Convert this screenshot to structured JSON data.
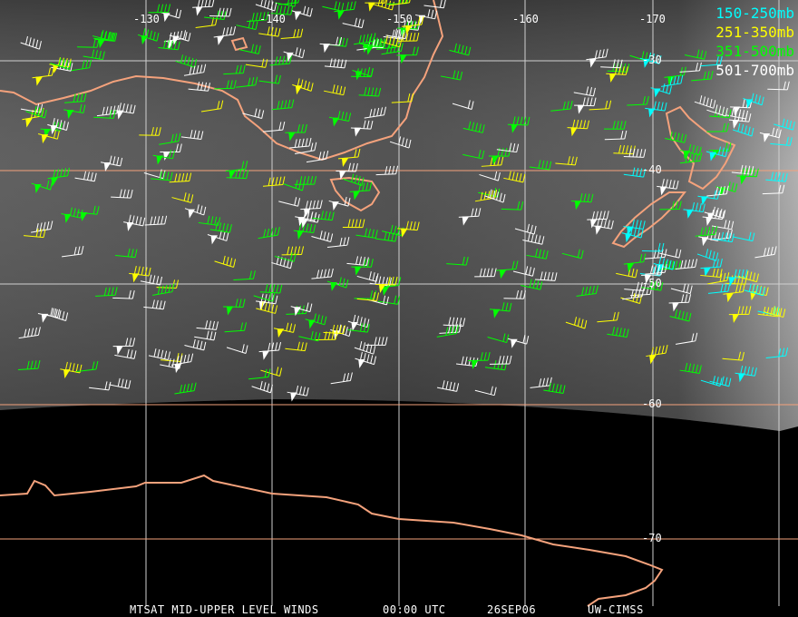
{
  "title": "MTSAT MID-UPPER LEVEL WINDS",
  "time": "00:00 UTC",
  "date": "26SEP06",
  "source": "UW-CIMSS",
  "longitude_labels": [
    "-130",
    "-140",
    "-150",
    "-160",
    "-170"
  ],
  "latitude_labels": [
    "-30",
    "-40",
    "-50",
    "-60",
    "-70"
  ],
  "legend": [
    {
      "label": "150-250mb",
      "color": "#00ffff"
    },
    {
      "label": "251-350mb",
      "color": "#ffff00"
    },
    {
      "label": "351-500mb",
      "color": "#00ff00"
    },
    {
      "label": "501-700mb",
      "color": "#ffffff"
    }
  ],
  "colors": {
    "coast": "#f4a27c",
    "grid_lat": "#f4a27c",
    "grid_lon": "#d0d0d0"
  }
}
